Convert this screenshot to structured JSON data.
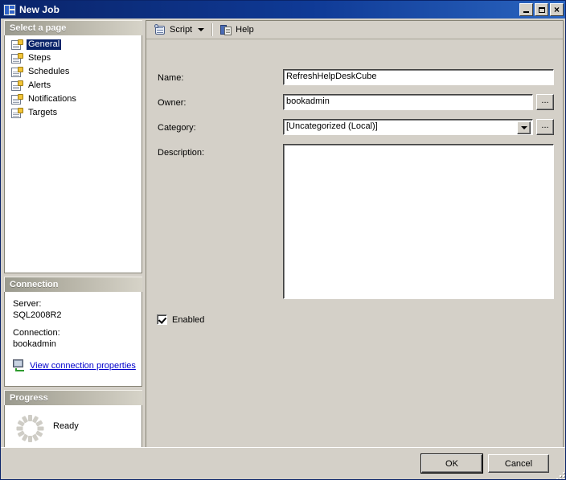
{
  "window": {
    "title": "New Job",
    "icon": "window-properties-icon",
    "controls": {
      "minimize": "Minimize",
      "maximize": "Maximize",
      "close": "Close"
    }
  },
  "sidebar": {
    "pages_header": "Select a page",
    "pages": [
      {
        "label": "General",
        "selected": true
      },
      {
        "label": "Steps",
        "selected": false
      },
      {
        "label": "Schedules",
        "selected": false
      },
      {
        "label": "Alerts",
        "selected": false
      },
      {
        "label": "Notifications",
        "selected": false
      },
      {
        "label": "Targets",
        "selected": false
      }
    ],
    "connection": {
      "header": "Connection",
      "server_label": "Server:",
      "server_value": "SQL2008R2",
      "connection_label": "Connection:",
      "connection_value": "bookadmin",
      "link": "View connection properties"
    },
    "progress": {
      "header": "Progress",
      "status": "Ready"
    }
  },
  "toolbar": {
    "script_label": "Script",
    "help_label": "Help"
  },
  "form": {
    "name_label": "Name:",
    "name_value": "RefreshHelpDeskCube",
    "owner_label": "Owner:",
    "owner_value": "bookadmin",
    "owner_browse": "...",
    "category_label": "Category:",
    "category_value": "[Uncategorized (Local)]",
    "category_browse": "...",
    "description_label": "Description:",
    "description_value": "",
    "enabled_label": "Enabled",
    "enabled_checked": true
  },
  "footer": {
    "ok_label": "OK",
    "cancel_label": "Cancel"
  },
  "colors": {
    "title_bar": "#0a246a",
    "dialog_face": "#d4d0c8",
    "selection": "#0a246a",
    "link": "#0000cc"
  }
}
